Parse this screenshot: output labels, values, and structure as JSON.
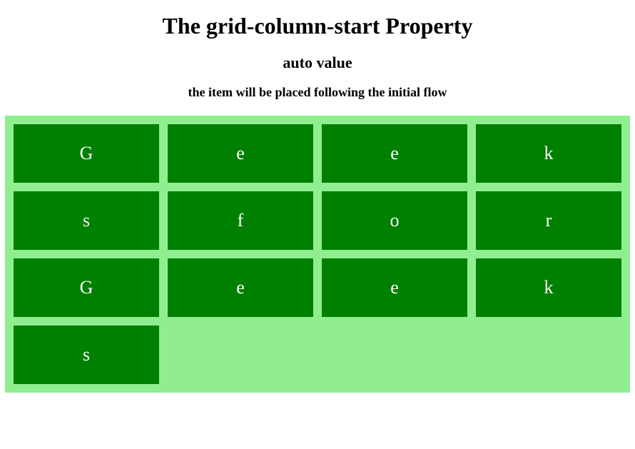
{
  "title": "The grid-column-start Property",
  "subtitle": "auto value",
  "description": "the item will be placed following the initial flow",
  "colors": {
    "container_bg": "#90ee90",
    "item_bg": "#008000",
    "item_text": "#ffffff"
  },
  "grid": {
    "items": [
      "G",
      "e",
      "e",
      "k",
      "s",
      "f",
      "o",
      "r",
      "G",
      "e",
      "e",
      "k",
      "s"
    ]
  }
}
